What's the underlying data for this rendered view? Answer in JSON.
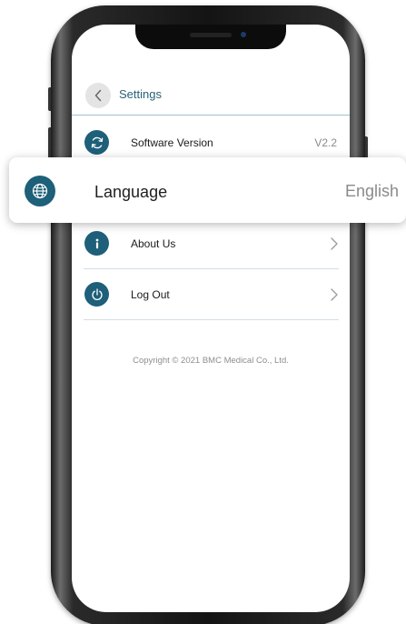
{
  "header": {
    "title": "Settings"
  },
  "settings_items": [
    {
      "label": "Software Version",
      "value": "V2.2",
      "icon": "refresh-icon"
    },
    {
      "label": "Language",
      "value": "English",
      "icon": "globe-icon"
    },
    {
      "label": "About Us",
      "icon": "info-icon"
    },
    {
      "label": "Log Out",
      "icon": "power-icon"
    }
  ],
  "copyright": "Copyright © 2021 BMC Medical Co., Ltd.",
  "colors": {
    "accent": "#1e5f79",
    "title_text": "#2a6275",
    "divider": "#9fc0d0"
  }
}
